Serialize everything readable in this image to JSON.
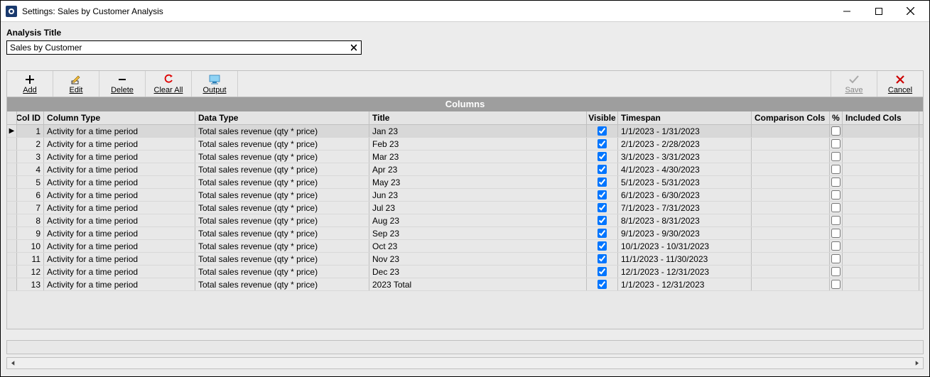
{
  "window": {
    "title": "Settings: Sales by Customer Analysis"
  },
  "form": {
    "analysis_title_label": "Analysis Title",
    "analysis_title_value": "Sales by Customer"
  },
  "toolbar": {
    "add": "Add",
    "edit": "Edit",
    "delete": "Delete",
    "clear_all": "Clear All",
    "output": "Output",
    "save": "Save",
    "cancel": "Cancel"
  },
  "section": {
    "columns": "Columns"
  },
  "grid": {
    "headers": {
      "col_id": "Col ID",
      "column_type": "Column Type",
      "data_type": "Data Type",
      "title": "Title",
      "visible": "Visible",
      "timespan": "Timespan",
      "comparison_cols": "Comparison Cols",
      "pct": "%",
      "included_cols": "Included Cols"
    },
    "rows": [
      {
        "id": "1",
        "column_type": "Activity for a time period",
        "data_type": "Total sales revenue (qty * price)",
        "title": "Jan 23",
        "visible": true,
        "timespan": "1/1/2023 - 1/31/2023",
        "comparison": "",
        "pct": false,
        "included": ""
      },
      {
        "id": "2",
        "column_type": "Activity for a time period",
        "data_type": "Total sales revenue (qty * price)",
        "title": "Feb 23",
        "visible": true,
        "timespan": "2/1/2023 - 2/28/2023",
        "comparison": "",
        "pct": false,
        "included": ""
      },
      {
        "id": "3",
        "column_type": "Activity for a time period",
        "data_type": "Total sales revenue (qty * price)",
        "title": "Mar 23",
        "visible": true,
        "timespan": "3/1/2023 - 3/31/2023",
        "comparison": "",
        "pct": false,
        "included": ""
      },
      {
        "id": "4",
        "column_type": "Activity for a time period",
        "data_type": "Total sales revenue (qty * price)",
        "title": "Apr 23",
        "visible": true,
        "timespan": "4/1/2023 - 4/30/2023",
        "comparison": "",
        "pct": false,
        "included": ""
      },
      {
        "id": "5",
        "column_type": "Activity for a time period",
        "data_type": "Total sales revenue (qty * price)",
        "title": "May 23",
        "visible": true,
        "timespan": "5/1/2023 - 5/31/2023",
        "comparison": "",
        "pct": false,
        "included": ""
      },
      {
        "id": "6",
        "column_type": "Activity for a time period",
        "data_type": "Total sales revenue (qty * price)",
        "title": "Jun 23",
        "visible": true,
        "timespan": "6/1/2023 - 6/30/2023",
        "comparison": "",
        "pct": false,
        "included": ""
      },
      {
        "id": "7",
        "column_type": "Activity for a time period",
        "data_type": "Total sales revenue (qty * price)",
        "title": "Jul 23",
        "visible": true,
        "timespan": "7/1/2023 - 7/31/2023",
        "comparison": "",
        "pct": false,
        "included": ""
      },
      {
        "id": "8",
        "column_type": "Activity for a time period",
        "data_type": "Total sales revenue (qty * price)",
        "title": "Aug 23",
        "visible": true,
        "timespan": "8/1/2023 - 8/31/2023",
        "comparison": "",
        "pct": false,
        "included": ""
      },
      {
        "id": "9",
        "column_type": "Activity for a time period",
        "data_type": "Total sales revenue (qty * price)",
        "title": "Sep 23",
        "visible": true,
        "timespan": "9/1/2023 - 9/30/2023",
        "comparison": "",
        "pct": false,
        "included": ""
      },
      {
        "id": "10",
        "column_type": "Activity for a time period",
        "data_type": "Total sales revenue (qty * price)",
        "title": "Oct 23",
        "visible": true,
        "timespan": "10/1/2023 - 10/31/2023",
        "comparison": "",
        "pct": false,
        "included": ""
      },
      {
        "id": "11",
        "column_type": "Activity for a time period",
        "data_type": "Total sales revenue (qty * price)",
        "title": "Nov 23",
        "visible": true,
        "timespan": "11/1/2023 - 11/30/2023",
        "comparison": "",
        "pct": false,
        "included": ""
      },
      {
        "id": "12",
        "column_type": "Activity for a time period",
        "data_type": "Total sales revenue (qty * price)",
        "title": "Dec 23",
        "visible": true,
        "timespan": "12/1/2023 - 12/31/2023",
        "comparison": "",
        "pct": false,
        "included": ""
      },
      {
        "id": "13",
        "column_type": "Activity for a time period",
        "data_type": "Total sales revenue (qty * price)",
        "title": "2023 Total",
        "visible": true,
        "timespan": "1/1/2023 - 12/31/2023",
        "comparison": "",
        "pct": false,
        "included": ""
      }
    ],
    "selected_index": 0
  }
}
